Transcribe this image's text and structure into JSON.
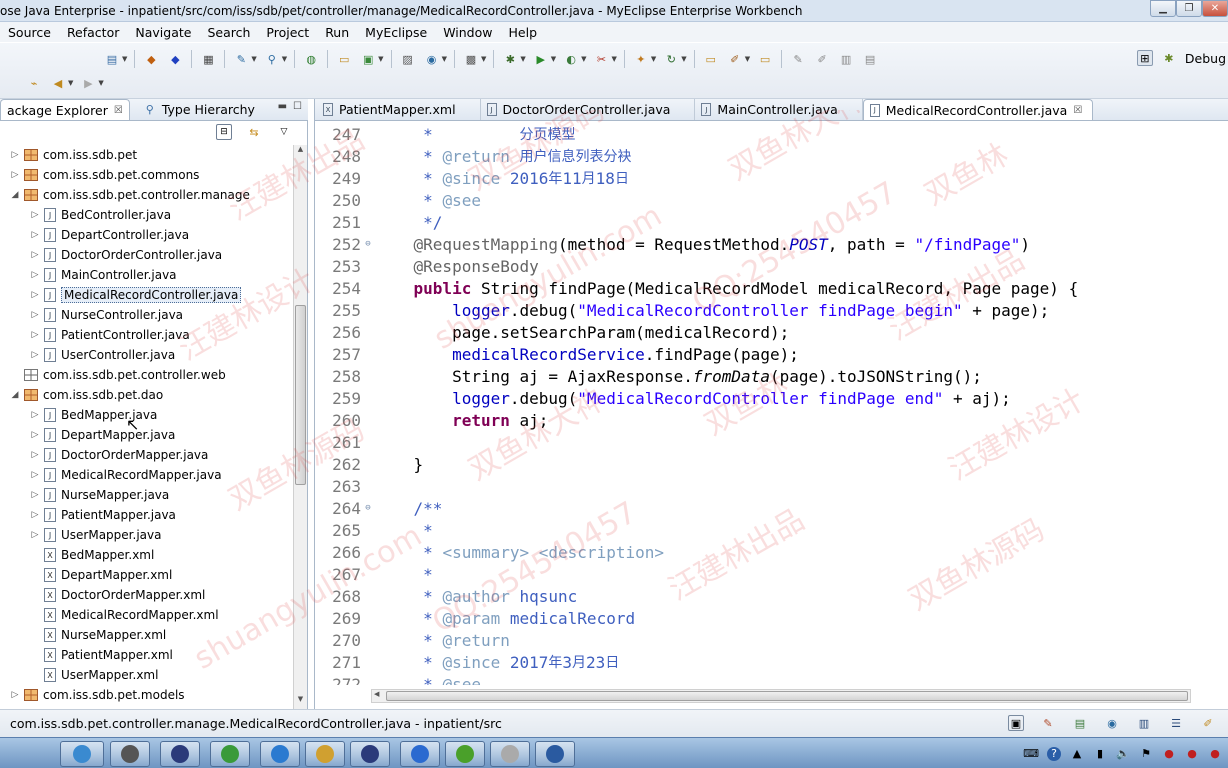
{
  "window": {
    "title": "ose Java Enterprise - inpatient/src/com/iss/sdb/pet/controller/manage/MedicalRecordController.java - MyEclipse Enterprise Workbench"
  },
  "menu": [
    "Source",
    "Refactor",
    "Navigate",
    "Search",
    "Project",
    "Run",
    "MyEclipse",
    "Window",
    "Help"
  ],
  "perspective": {
    "label": "Debug"
  },
  "left_panel": {
    "tabs": [
      {
        "label": "ackage Explorer",
        "active": true
      },
      {
        "label": "Type Hierarchy",
        "active": false
      }
    ],
    "tree": [
      {
        "label": "com.iss.sdb.pet",
        "type": "package",
        "expanded": false,
        "depth": 0
      },
      {
        "label": "com.iss.sdb.pet.commons",
        "type": "package",
        "expanded": false,
        "depth": 0
      },
      {
        "label": "com.iss.sdb.pet.controller.manage",
        "type": "package",
        "expanded": true,
        "depth": 0
      },
      {
        "label": "BedController.java",
        "type": "java",
        "depth": 1
      },
      {
        "label": "DepartController.java",
        "type": "java",
        "depth": 1
      },
      {
        "label": "DoctorOrderController.java",
        "type": "java",
        "depth": 1
      },
      {
        "label": "MainController.java",
        "type": "java",
        "depth": 1
      },
      {
        "label": "MedicalRecordController.java",
        "type": "java",
        "depth": 1,
        "selected": true
      },
      {
        "label": "NurseController.java",
        "type": "java",
        "depth": 1
      },
      {
        "label": "PatientController.java",
        "type": "java",
        "depth": 1
      },
      {
        "label": "UserController.java",
        "type": "java",
        "depth": 1
      },
      {
        "label": "com.iss.sdb.pet.controller.web",
        "type": "package-empty",
        "expanded": null,
        "depth": 0
      },
      {
        "label": "com.iss.sdb.pet.dao",
        "type": "package",
        "expanded": true,
        "depth": 0
      },
      {
        "label": "BedMapper.java",
        "type": "java",
        "depth": 1,
        "hover": true
      },
      {
        "label": "DepartMapper.java",
        "type": "java",
        "depth": 1
      },
      {
        "label": "DoctorOrderMapper.java",
        "type": "java",
        "depth": 1
      },
      {
        "label": "MedicalRecordMapper.java",
        "type": "java",
        "depth": 1
      },
      {
        "label": "NurseMapper.java",
        "type": "java",
        "depth": 1
      },
      {
        "label": "PatientMapper.java",
        "type": "java",
        "depth": 1
      },
      {
        "label": "UserMapper.java",
        "type": "java",
        "depth": 1
      },
      {
        "label": "BedMapper.xml",
        "type": "xml",
        "depth": 1
      },
      {
        "label": "DepartMapper.xml",
        "type": "xml",
        "depth": 1
      },
      {
        "label": "DoctorOrderMapper.xml",
        "type": "xml",
        "depth": 1
      },
      {
        "label": "MedicalRecordMapper.xml",
        "type": "xml",
        "depth": 1
      },
      {
        "label": "NurseMapper.xml",
        "type": "xml",
        "depth": 1
      },
      {
        "label": "PatientMapper.xml",
        "type": "xml",
        "depth": 1
      },
      {
        "label": "UserMapper.xml",
        "type": "xml",
        "depth": 1
      },
      {
        "label": "com.iss.sdb.pet.models",
        "type": "package",
        "expanded": false,
        "depth": 0
      }
    ]
  },
  "editor": {
    "tabs": [
      {
        "label": "PatientMapper.xml",
        "active": false
      },
      {
        "label": "DoctorOrderController.java",
        "active": false
      },
      {
        "label": "MainController.java",
        "active": false
      },
      {
        "label": "MedicalRecordController.java",
        "active": true
      }
    ],
    "lines": [
      {
        "num": "247",
        "fold": "",
        "segs": [
          [
            "c-comment",
            "     *         "
          ],
          [
            "c-comment c-cn",
            "分页模型"
          ]
        ]
      },
      {
        "num": "248",
        "fold": "",
        "segs": [
          [
            "c-comment",
            "     * "
          ],
          [
            "c-tag",
            "@return"
          ],
          [
            "c-comment",
            " "
          ],
          [
            "c-comment c-cn",
            "用户信息列表分袂"
          ]
        ]
      },
      {
        "num": "249",
        "fold": "",
        "segs": [
          [
            "c-comment",
            "     * "
          ],
          [
            "c-tag",
            "@since"
          ],
          [
            "c-comment",
            " 2016"
          ],
          [
            "c-comment c-cn",
            "年"
          ],
          [
            "c-comment",
            "11"
          ],
          [
            "c-comment c-cn",
            "月"
          ],
          [
            "c-comment",
            "18"
          ],
          [
            "c-comment c-cn",
            "日"
          ]
        ]
      },
      {
        "num": "250",
        "fold": "",
        "segs": [
          [
            "c-comment",
            "     * "
          ],
          [
            "c-tag",
            "@see"
          ]
        ]
      },
      {
        "num": "251",
        "fold": "",
        "segs": [
          [
            "c-comment",
            "     */"
          ]
        ]
      },
      {
        "num": "252",
        "fold": "⊖",
        "segs": [
          [
            "c-ann",
            "    @RequestMapping"
          ],
          [
            "ctext",
            "(method = RequestMethod."
          ],
          [
            "c-field c-ital",
            "POST"
          ],
          [
            "ctext",
            ", path = "
          ],
          [
            "c-str",
            "\"/findPage\""
          ],
          [
            "ctext",
            ")"
          ]
        ]
      },
      {
        "num": "253",
        "fold": "",
        "segs": [
          [
            "c-ann",
            "    @ResponseBody"
          ]
        ]
      },
      {
        "num": "254",
        "fold": "",
        "segs": [
          [
            "c-kw",
            "    public"
          ],
          [
            "ctext",
            " String findPage(MedicalRecordModel medicalRecord, Page page) {"
          ]
        ]
      },
      {
        "num": "255",
        "fold": "",
        "segs": [
          [
            "c-field",
            "        logger"
          ],
          [
            "ctext",
            ".debug("
          ],
          [
            "c-str",
            "\"MedicalRecordController findPage begin\""
          ],
          [
            "ctext",
            " + page);"
          ]
        ]
      },
      {
        "num": "256",
        "fold": "",
        "segs": [
          [
            "ctext",
            "        page.setSearchParam(medicalRecord);"
          ]
        ]
      },
      {
        "num": "257",
        "fold": "",
        "segs": [
          [
            "c-field",
            "        medicalRecordService"
          ],
          [
            "ctext",
            ".findPage(page);"
          ]
        ]
      },
      {
        "num": "258",
        "fold": "",
        "segs": [
          [
            "ctext",
            "        String aj = AjaxResponse."
          ],
          [
            "ctext c-ital",
            "fromData"
          ],
          [
            "ctext",
            "(page).toJSONString();"
          ]
        ]
      },
      {
        "num": "259",
        "fold": "",
        "segs": [
          [
            "c-field",
            "        logger"
          ],
          [
            "ctext",
            ".debug("
          ],
          [
            "c-str",
            "\"MedicalRecordController findPage end\""
          ],
          [
            "ctext",
            " + aj);"
          ]
        ]
      },
      {
        "num": "260",
        "fold": "",
        "segs": [
          [
            "c-kw",
            "        return"
          ],
          [
            "ctext",
            " aj;"
          ]
        ]
      },
      {
        "num": "261",
        "fold": "",
        "segs": [
          [
            "ctext",
            ""
          ]
        ]
      },
      {
        "num": "262",
        "fold": "",
        "segs": [
          [
            "ctext",
            "    }"
          ]
        ]
      },
      {
        "num": "263",
        "fold": "",
        "segs": [
          [
            "ctext",
            ""
          ]
        ]
      },
      {
        "num": "264",
        "fold": "⊖",
        "segs": [
          [
            "c-comment",
            "    /**"
          ]
        ]
      },
      {
        "num": "265",
        "fold": "",
        "segs": [
          [
            "c-comment",
            "     *"
          ]
        ]
      },
      {
        "num": "266",
        "fold": "",
        "segs": [
          [
            "c-comment",
            "     * "
          ],
          [
            "c-tag",
            "<summary> <description>"
          ]
        ]
      },
      {
        "num": "267",
        "fold": "",
        "segs": [
          [
            "c-comment",
            "     *"
          ]
        ]
      },
      {
        "num": "268",
        "fold": "",
        "segs": [
          [
            "c-comment",
            "     * "
          ],
          [
            "c-tag",
            "@author"
          ],
          [
            "c-comment",
            " hqsunc"
          ]
        ]
      },
      {
        "num": "269",
        "fold": "",
        "segs": [
          [
            "c-comment",
            "     * "
          ],
          [
            "c-tag",
            "@param"
          ],
          [
            "c-comment",
            " medicalRecord"
          ]
        ]
      },
      {
        "num": "270",
        "fold": "",
        "segs": [
          [
            "c-comment",
            "     * "
          ],
          [
            "c-tag",
            "@return"
          ]
        ]
      },
      {
        "num": "271",
        "fold": "",
        "segs": [
          [
            "c-comment",
            "     * "
          ],
          [
            "c-tag",
            "@since"
          ],
          [
            "c-comment",
            " 2017"
          ],
          [
            "c-comment c-cn",
            "年"
          ],
          [
            "c-comment",
            "3"
          ],
          [
            "c-comment c-cn",
            "月"
          ],
          [
            "c-comment",
            "23"
          ],
          [
            "c-comment c-cn",
            "日"
          ]
        ]
      },
      {
        "num": "272",
        "fold": "",
        "segs": [
          [
            "c-comment",
            "     * "
          ],
          [
            "c-tag",
            "@see"
          ]
        ]
      }
    ]
  },
  "status": {
    "text": "com.iss.sdb.pet.controller.manage.MedicalRecordController.java - inpatient/src"
  },
  "watermark": {
    "texts": [
      "汪建林出品",
      "双鱼林源码",
      "双鱼林大神",
      "双鱼林",
      "汪建林设计",
      "shuangyulin.com",
      "QQ:254540457"
    ]
  }
}
